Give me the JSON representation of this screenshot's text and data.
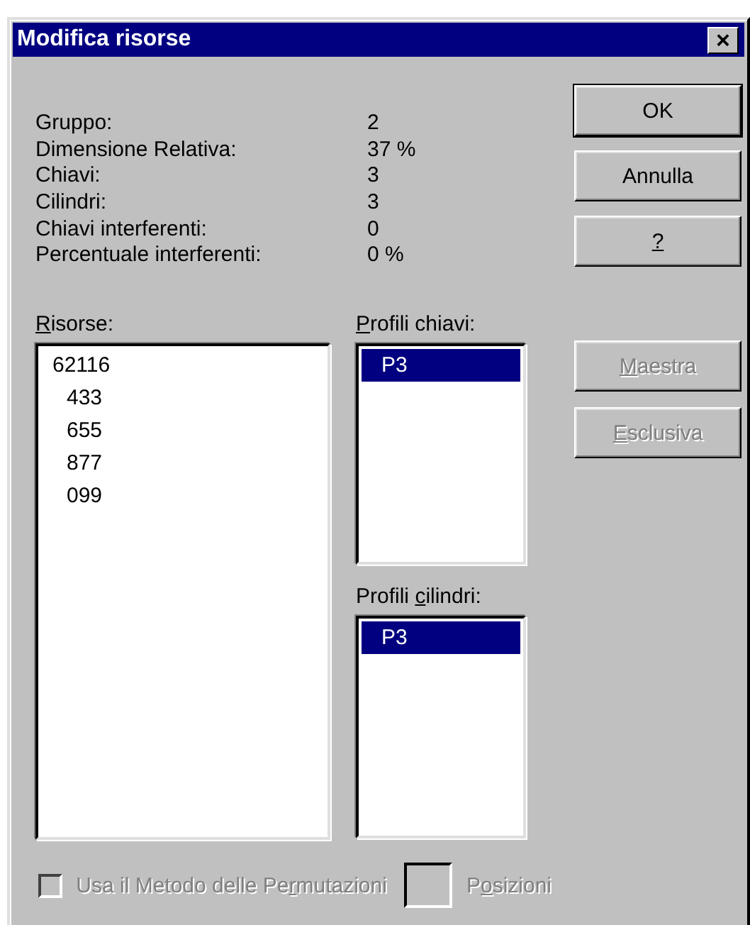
{
  "window": {
    "title": "Modifica risorse",
    "close": "×"
  },
  "stats": [
    {
      "label": "Gruppo:",
      "value": "2"
    },
    {
      "label": "Dimensione Relativa:",
      "value": "37 %"
    },
    {
      "label": "Chiavi:",
      "value": "3"
    },
    {
      "label": "Cilindri:",
      "value": "3"
    },
    {
      "label": "Chiavi interferenti:",
      "value": "0"
    },
    {
      "label": "Percentuale interferenti:",
      "value": "0 %"
    }
  ],
  "top_buttons": [
    {
      "label": "OK",
      "default": true,
      "disabled": false
    },
    {
      "label": "Annulla",
      "default": false,
      "disabled": false
    },
    {
      "label": {
        "key": "?"
      },
      "default": false,
      "disabled": false
    }
  ],
  "resources": {
    "label": {
      "key": "R",
      "post": "isorse:"
    },
    "items": [
      {
        "text": "62116",
        "children": [
          {
            "text": "433"
          },
          {
            "text": "655"
          },
          {
            "text": "877"
          },
          {
            "text": "099"
          }
        ]
      }
    ]
  },
  "key_profiles": {
    "label": {
      "key": "P",
      "post": "rofili chiavi:"
    },
    "items": [
      {
        "text": "P3",
        "selected": true
      }
    ]
  },
  "cylinder_profiles": {
    "label": {
      "pre": "Profili ",
      "key": "c",
      "post": "ilindri:"
    },
    "items": [
      {
        "text": "P3",
        "selected": true
      }
    ]
  },
  "side_buttons": [
    {
      "label": {
        "key": "M",
        "post": "aestra"
      },
      "disabled": true
    },
    {
      "label": {
        "key": "E",
        "post": "sclusiva"
      },
      "disabled": true
    }
  ],
  "permutations": {
    "label": {
      "pre": "Usa il Metodo delle Pe",
      "key": "r",
      "post": "mutazioni"
    },
    "checked": false,
    "disabled": true
  },
  "positions": {
    "label": {
      "pre": "P",
      "key": "o",
      "post": "sizioni"
    },
    "disabled": true
  }
}
